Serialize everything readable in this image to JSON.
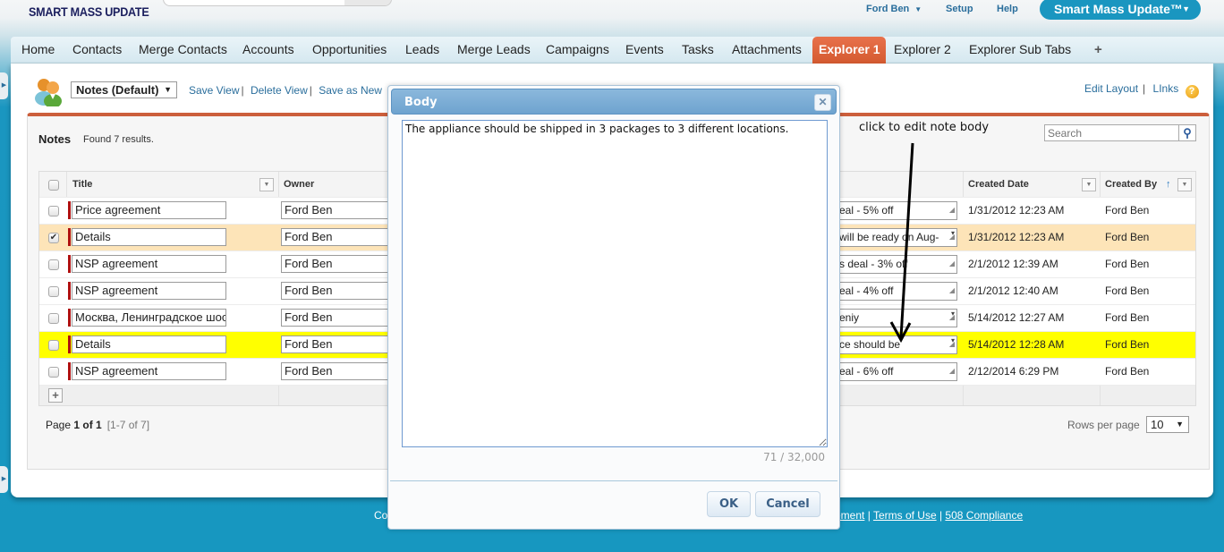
{
  "header": {
    "logo_text": "SMART MASS UPDATE",
    "user_name": "Ford Ben",
    "setup_label": "Setup",
    "help_label": "Help",
    "app_button_label": "Smart Mass Update™"
  },
  "tabs": [
    {
      "label": "Home"
    },
    {
      "label": "Contacts"
    },
    {
      "label": "Merge Contacts"
    },
    {
      "label": "Accounts"
    },
    {
      "label": "Opportunities"
    },
    {
      "label": "Leads"
    },
    {
      "label": "Merge Leads"
    },
    {
      "label": "Campaigns"
    },
    {
      "label": "Events"
    },
    {
      "label": "Tasks"
    },
    {
      "label": "Attachments"
    },
    {
      "label": "Explorer 1",
      "active": true
    },
    {
      "label": "Explorer 2"
    },
    {
      "label": "Explorer Sub Tabs"
    },
    {
      "label": "+"
    }
  ],
  "view": {
    "selected": "Notes (Default)",
    "save_view": "Save View",
    "delete_view": "Delete View",
    "save_as_new": "Save as New",
    "edit_layout": "Edit Layout",
    "links": "LInks",
    "help_glyph": "?"
  },
  "panel": {
    "title": "Notes",
    "count_text": "Found 7 results.",
    "search_placeholder": "Search",
    "annotation": "click to edit note body"
  },
  "grid": {
    "columns": {
      "title": "Title",
      "owner": "Owner",
      "created_date": "Created Date",
      "created_by": "Created By"
    },
    "rows": [
      {
        "title": "Price agreement",
        "owner": "Ford Ben",
        "body": "eal - 5% off",
        "created_date": "1/31/2012 12:23 AM",
        "created_by": "Ford Ben",
        "checked": false,
        "state": "normal"
      },
      {
        "title": "Details",
        "owner": "Ford Ben",
        "body": "will be ready on Aug-",
        "created_date": "1/31/2012 12:23 AM",
        "created_by": "Ford Ben",
        "checked": true,
        "state": "selected"
      },
      {
        "title": "NSP agreement",
        "owner": "Ford Ben",
        "body": "s deal - 3% off",
        "created_date": "2/1/2012 12:39 AM",
        "created_by": "Ford Ben",
        "checked": false,
        "state": "normal"
      },
      {
        "title": "NSP agreement",
        "owner": "Ford Ben",
        "body": "eal - 4% off",
        "created_date": "2/1/2012 12:40 AM",
        "created_by": "Ford Ben",
        "checked": false,
        "state": "normal"
      },
      {
        "title": "Москва, Ленинградское шоссе",
        "owner": "Ford Ben",
        "body": "eniy",
        "created_date": "5/14/2012 12:27 AM",
        "created_by": "Ford Ben",
        "checked": false,
        "state": "normal"
      },
      {
        "title": "Details",
        "owner": "Ford Ben",
        "body": "ce should be",
        "created_date": "5/14/2012 12:28 AM",
        "created_by": "Ford Ben",
        "checked": false,
        "state": "highlight"
      },
      {
        "title": "NSP agreement",
        "owner": "Ford Ben",
        "body": "eal - 6% off",
        "created_date": "2/12/2014 6:29 PM",
        "created_by": "Ford Ben",
        "checked": false,
        "state": "normal"
      }
    ]
  },
  "pager": {
    "page_prefix": "Page ",
    "page_bold": "1 of 1",
    "range": "[1-7 of 7]",
    "rows_per_page_label": "Rows per page",
    "rows_per_page": "10"
  },
  "footer": {
    "left_fragment": "Co",
    "links": [
      "atement",
      "Terms of Use",
      "508 Compliance"
    ]
  },
  "modal": {
    "title": "Body",
    "body_text": "The appliance should be shipped in 3 packages to 3 different locations.",
    "char_count": "71 / 32,000",
    "ok_label": "OK",
    "cancel_label": "Cancel"
  },
  "colors": {
    "accent_orange": "#cc5f3c",
    "brand_blue": "#1a96c0",
    "selected_row": "#fde4b8",
    "highlight_row": "#ffff00"
  }
}
